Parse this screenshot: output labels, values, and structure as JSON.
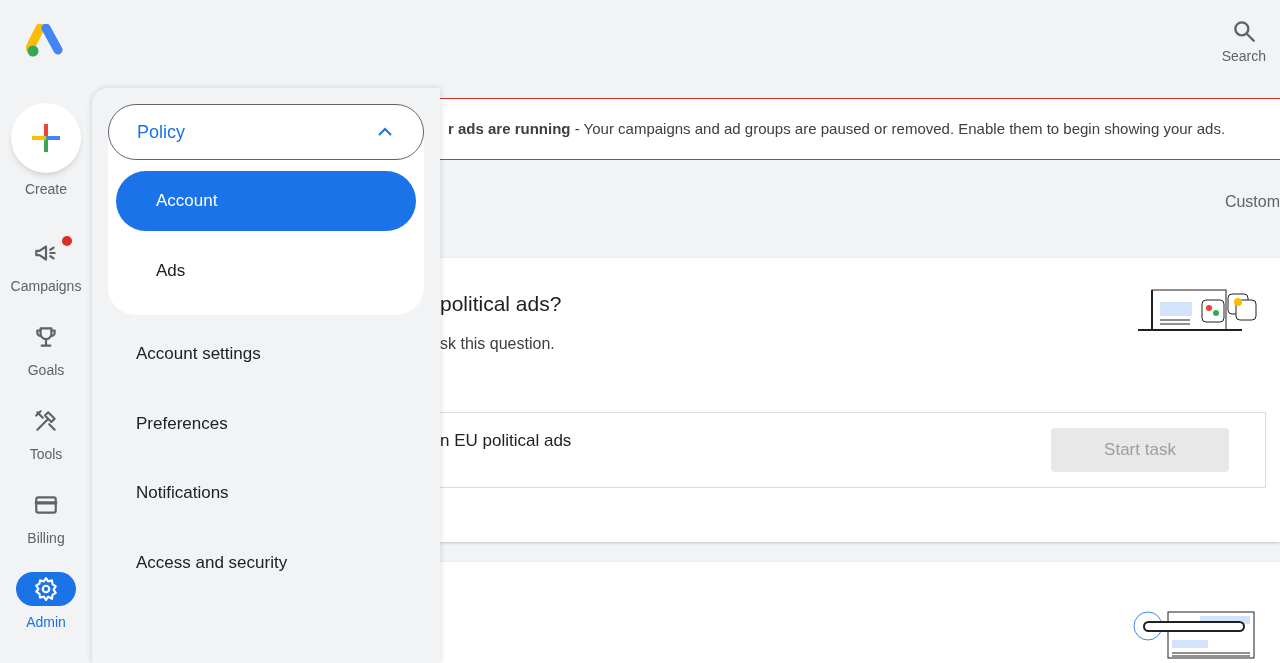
{
  "header": {
    "search_label": "Search"
  },
  "rail": {
    "create_label": "Create",
    "items": [
      {
        "label": "Campaigns",
        "selected": false,
        "notification": true
      },
      {
        "label": "Goals",
        "selected": false,
        "notification": false
      },
      {
        "label": "Tools",
        "selected": false,
        "notification": false
      },
      {
        "label": "Billing",
        "selected": false,
        "notification": false
      },
      {
        "label": "Admin",
        "selected": true,
        "notification": false
      }
    ]
  },
  "admin_menu": {
    "group": {
      "label": "Policy",
      "expanded": true,
      "items": [
        {
          "label": "Account",
          "selected": true
        },
        {
          "label": "Ads",
          "selected": false
        }
      ]
    },
    "items": [
      "Account settings",
      "Preferences",
      "Notifications",
      "Access and security"
    ]
  },
  "banner": {
    "bold": "r ads are running",
    "text": " - Your campaigns and ad groups are paused or removed. Enable them to begin showing your ads."
  },
  "toolbar": {
    "right_label": "Custom"
  },
  "card": {
    "title": "political ads?",
    "subtitle": "sk this question.",
    "task": {
      "label": "n EU political ads",
      "button": "Start task",
      "disabled": true
    }
  }
}
